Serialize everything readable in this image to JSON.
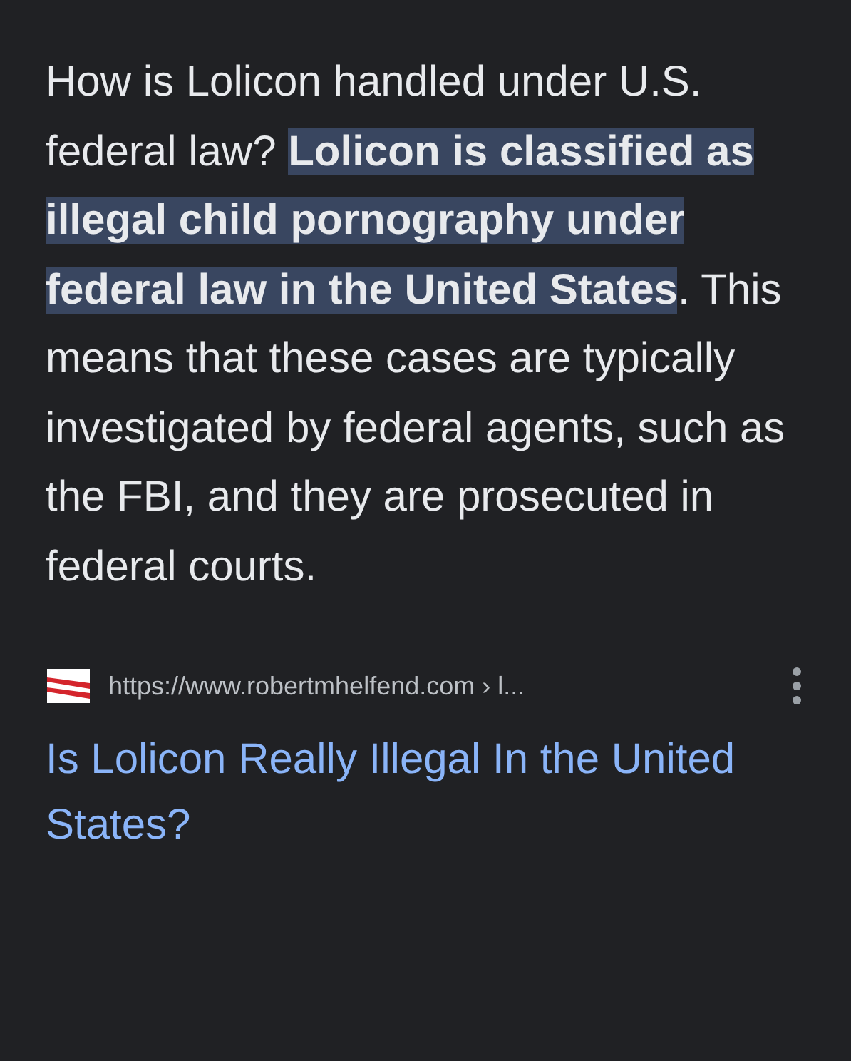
{
  "answer": {
    "text": "How is Lolicon handled under U.S. federal law? **Lolicon is classified as illegal child pornography under federal law in the United States**. This means that these cases are typically investigated by federal agents, such as the FBI, and they are prosecuted in federal courts."
  },
  "source": {
    "url": "https://www.robertmhelfend.com › l...",
    "title": "Is Lolicon Really Illegal In the United States?"
  }
}
